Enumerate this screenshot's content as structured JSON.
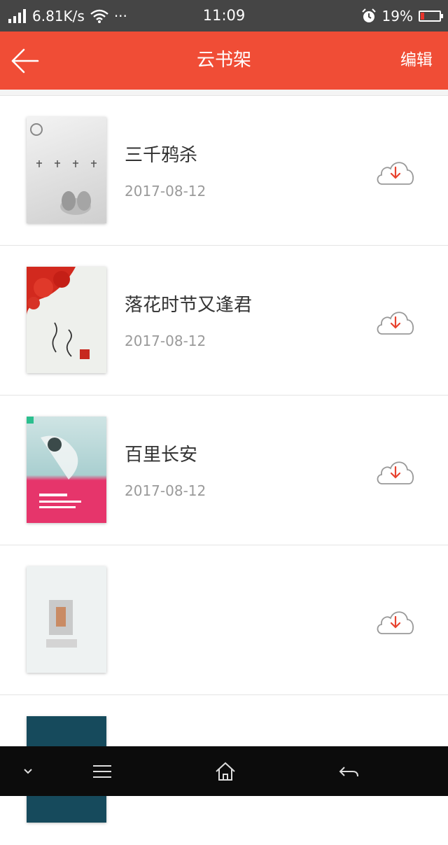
{
  "status_bar": {
    "speed": "6.81K/s",
    "more": "···",
    "time": "11:09",
    "battery": "19%",
    "icons": [
      "signal-icon",
      "wifi-icon",
      "alarm-icon",
      "battery-icon"
    ]
  },
  "header": {
    "title": "云书架",
    "edit": "编辑",
    "back_icon": "arrow-left-icon"
  },
  "books": [
    {
      "title": "三千鸦杀",
      "date": "2017-08-12"
    },
    {
      "title": "落花时节又逢君",
      "date": "2017-08-12"
    },
    {
      "title": "百里长安",
      "date": "2017-08-12"
    },
    {
      "title": "",
      "date": ""
    }
  ],
  "colors": {
    "accent": "#f04d36",
    "status_bar": "#454545",
    "nav_bar": "#0c0c0c",
    "download_arrow": "#e8432f"
  },
  "nav": {
    "icons": [
      "chevron-down-icon",
      "menu-icon",
      "home-icon",
      "back-icon"
    ]
  }
}
